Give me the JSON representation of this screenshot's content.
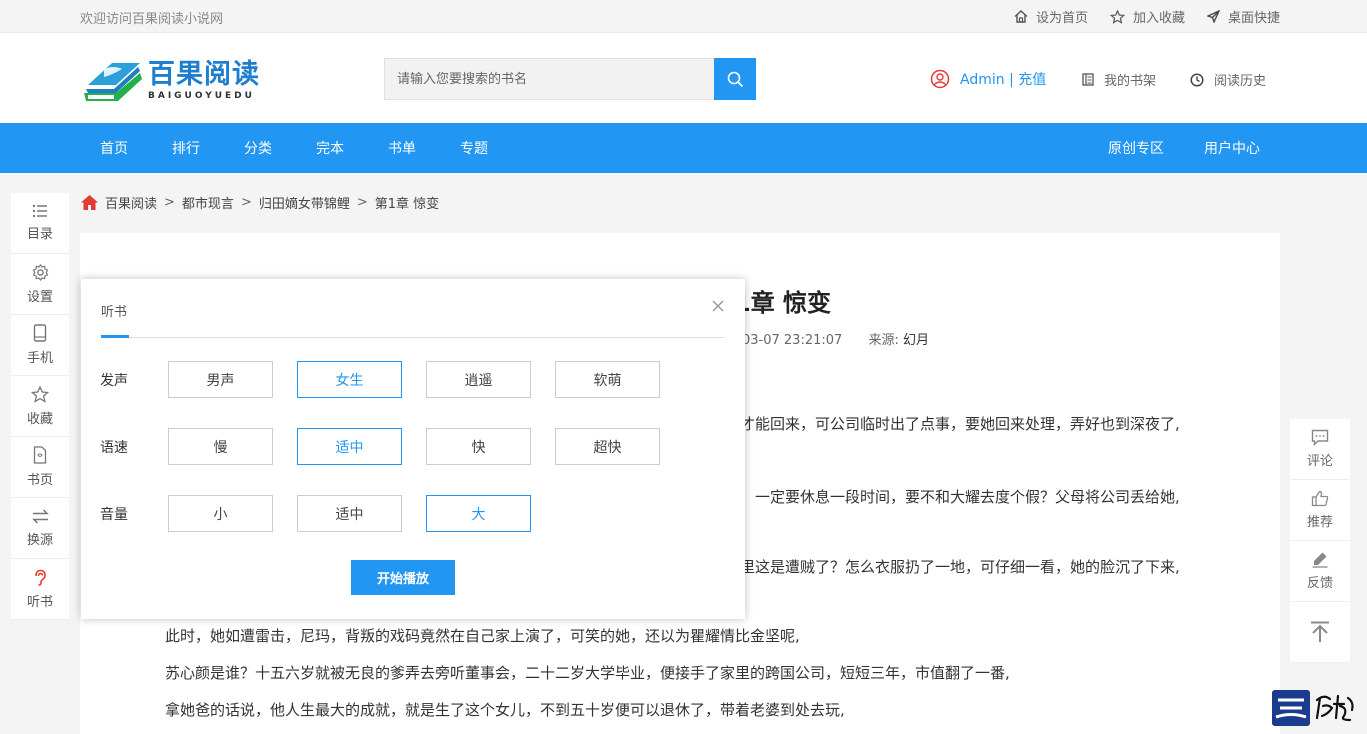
{
  "topbar": {
    "welcome": "欢迎访问百果阅读小说网",
    "links": [
      {
        "label": "设为首页",
        "icon": "home-icon"
      },
      {
        "label": "加入收藏",
        "icon": "star-icon"
      },
      {
        "label": "桌面快捷",
        "icon": "send-icon"
      }
    ]
  },
  "header": {
    "logo_cn": "百果阅读",
    "logo_en": "BAIGUOYUEDU",
    "search_placeholder": "请输入您要搜索的书名",
    "user_name": "Admin",
    "user_sep": "|",
    "recharge": "充值",
    "links": [
      {
        "label": "我的书架",
        "icon": "bookshelf-icon"
      },
      {
        "label": "阅读历史",
        "icon": "clock-icon"
      }
    ]
  },
  "nav": {
    "left": [
      "首页",
      "排行",
      "分类",
      "完本",
      "书单",
      "专题"
    ],
    "right": [
      "原创专区",
      "用户中心"
    ]
  },
  "breadcrumb": {
    "items": [
      "百果阅读",
      "都市现言",
      "归田嫡女带锦鲤",
      "第1章 惊变"
    ],
    "sep": ">"
  },
  "left_sidebar": [
    {
      "label": "目录",
      "icon": "list-icon"
    },
    {
      "label": "设置",
      "icon": "gear-icon"
    },
    {
      "label": "手机",
      "icon": "phone-icon"
    },
    {
      "label": "收藏",
      "icon": "star-icon"
    },
    {
      "label": "书页",
      "icon": "book-page-icon"
    },
    {
      "label": "换源",
      "icon": "swap-icon"
    },
    {
      "label": "听书",
      "icon": "ear-icon"
    }
  ],
  "chapter": {
    "title": "第1章 惊变",
    "title_visible": "1章 惊变",
    "time_visible": "03-07 23:21:07",
    "source_label": "来源:",
    "source_value": "幻月",
    "paragraphs_visible": [
      "才能回来，可公司临时出了点事，要她回来处理，弄好也到深夜了,",
      "，一定要休息一段时间，要不和大耀去度个假？父母将公司丢给她,",
      "里这是遭贼了？怎么衣服扔了一地，可仔细一看，她的脸沉了下来,",
      "此时，她如遭雷击，尼玛，背叛的戏码竟然在自己家上演了，可笑的她，还以为瞿耀情比金坚呢,",
      "苏心颜是谁？十五六岁就被无良的爹弄去旁听董事会，二十二岁大学毕业，便接手了家里的跨国公司，短短三年，市值翻了一番,",
      "拿她爸的话说，他人生最大的成就，就是生了这个女儿，不到五十岁便可以退休了，带着老婆到处去玩,"
    ]
  },
  "right_sidebar": [
    {
      "label": "评论",
      "icon": "comment-icon"
    },
    {
      "label": "推荐",
      "icon": "thumbs-up-icon"
    },
    {
      "label": "反馈",
      "icon": "edit-icon"
    },
    {
      "label": "",
      "icon": "back-to-top-icon"
    }
  ],
  "listen_popup": {
    "title": "听书",
    "rows": [
      {
        "label": "发声",
        "options": [
          "男声",
          "女生",
          "逍遥",
          "软萌"
        ],
        "selected": 1
      },
      {
        "label": "语速",
        "options": [
          "慢",
          "适中",
          "快",
          "超快"
        ],
        "selected": 1
      },
      {
        "label": "音量",
        "options": [
          "小",
          "适中",
          "大"
        ],
        "selected": 2
      }
    ],
    "play_button": "开始播放"
  },
  "colors": {
    "primary": "#2196f3",
    "accent_red": "#e53935"
  }
}
